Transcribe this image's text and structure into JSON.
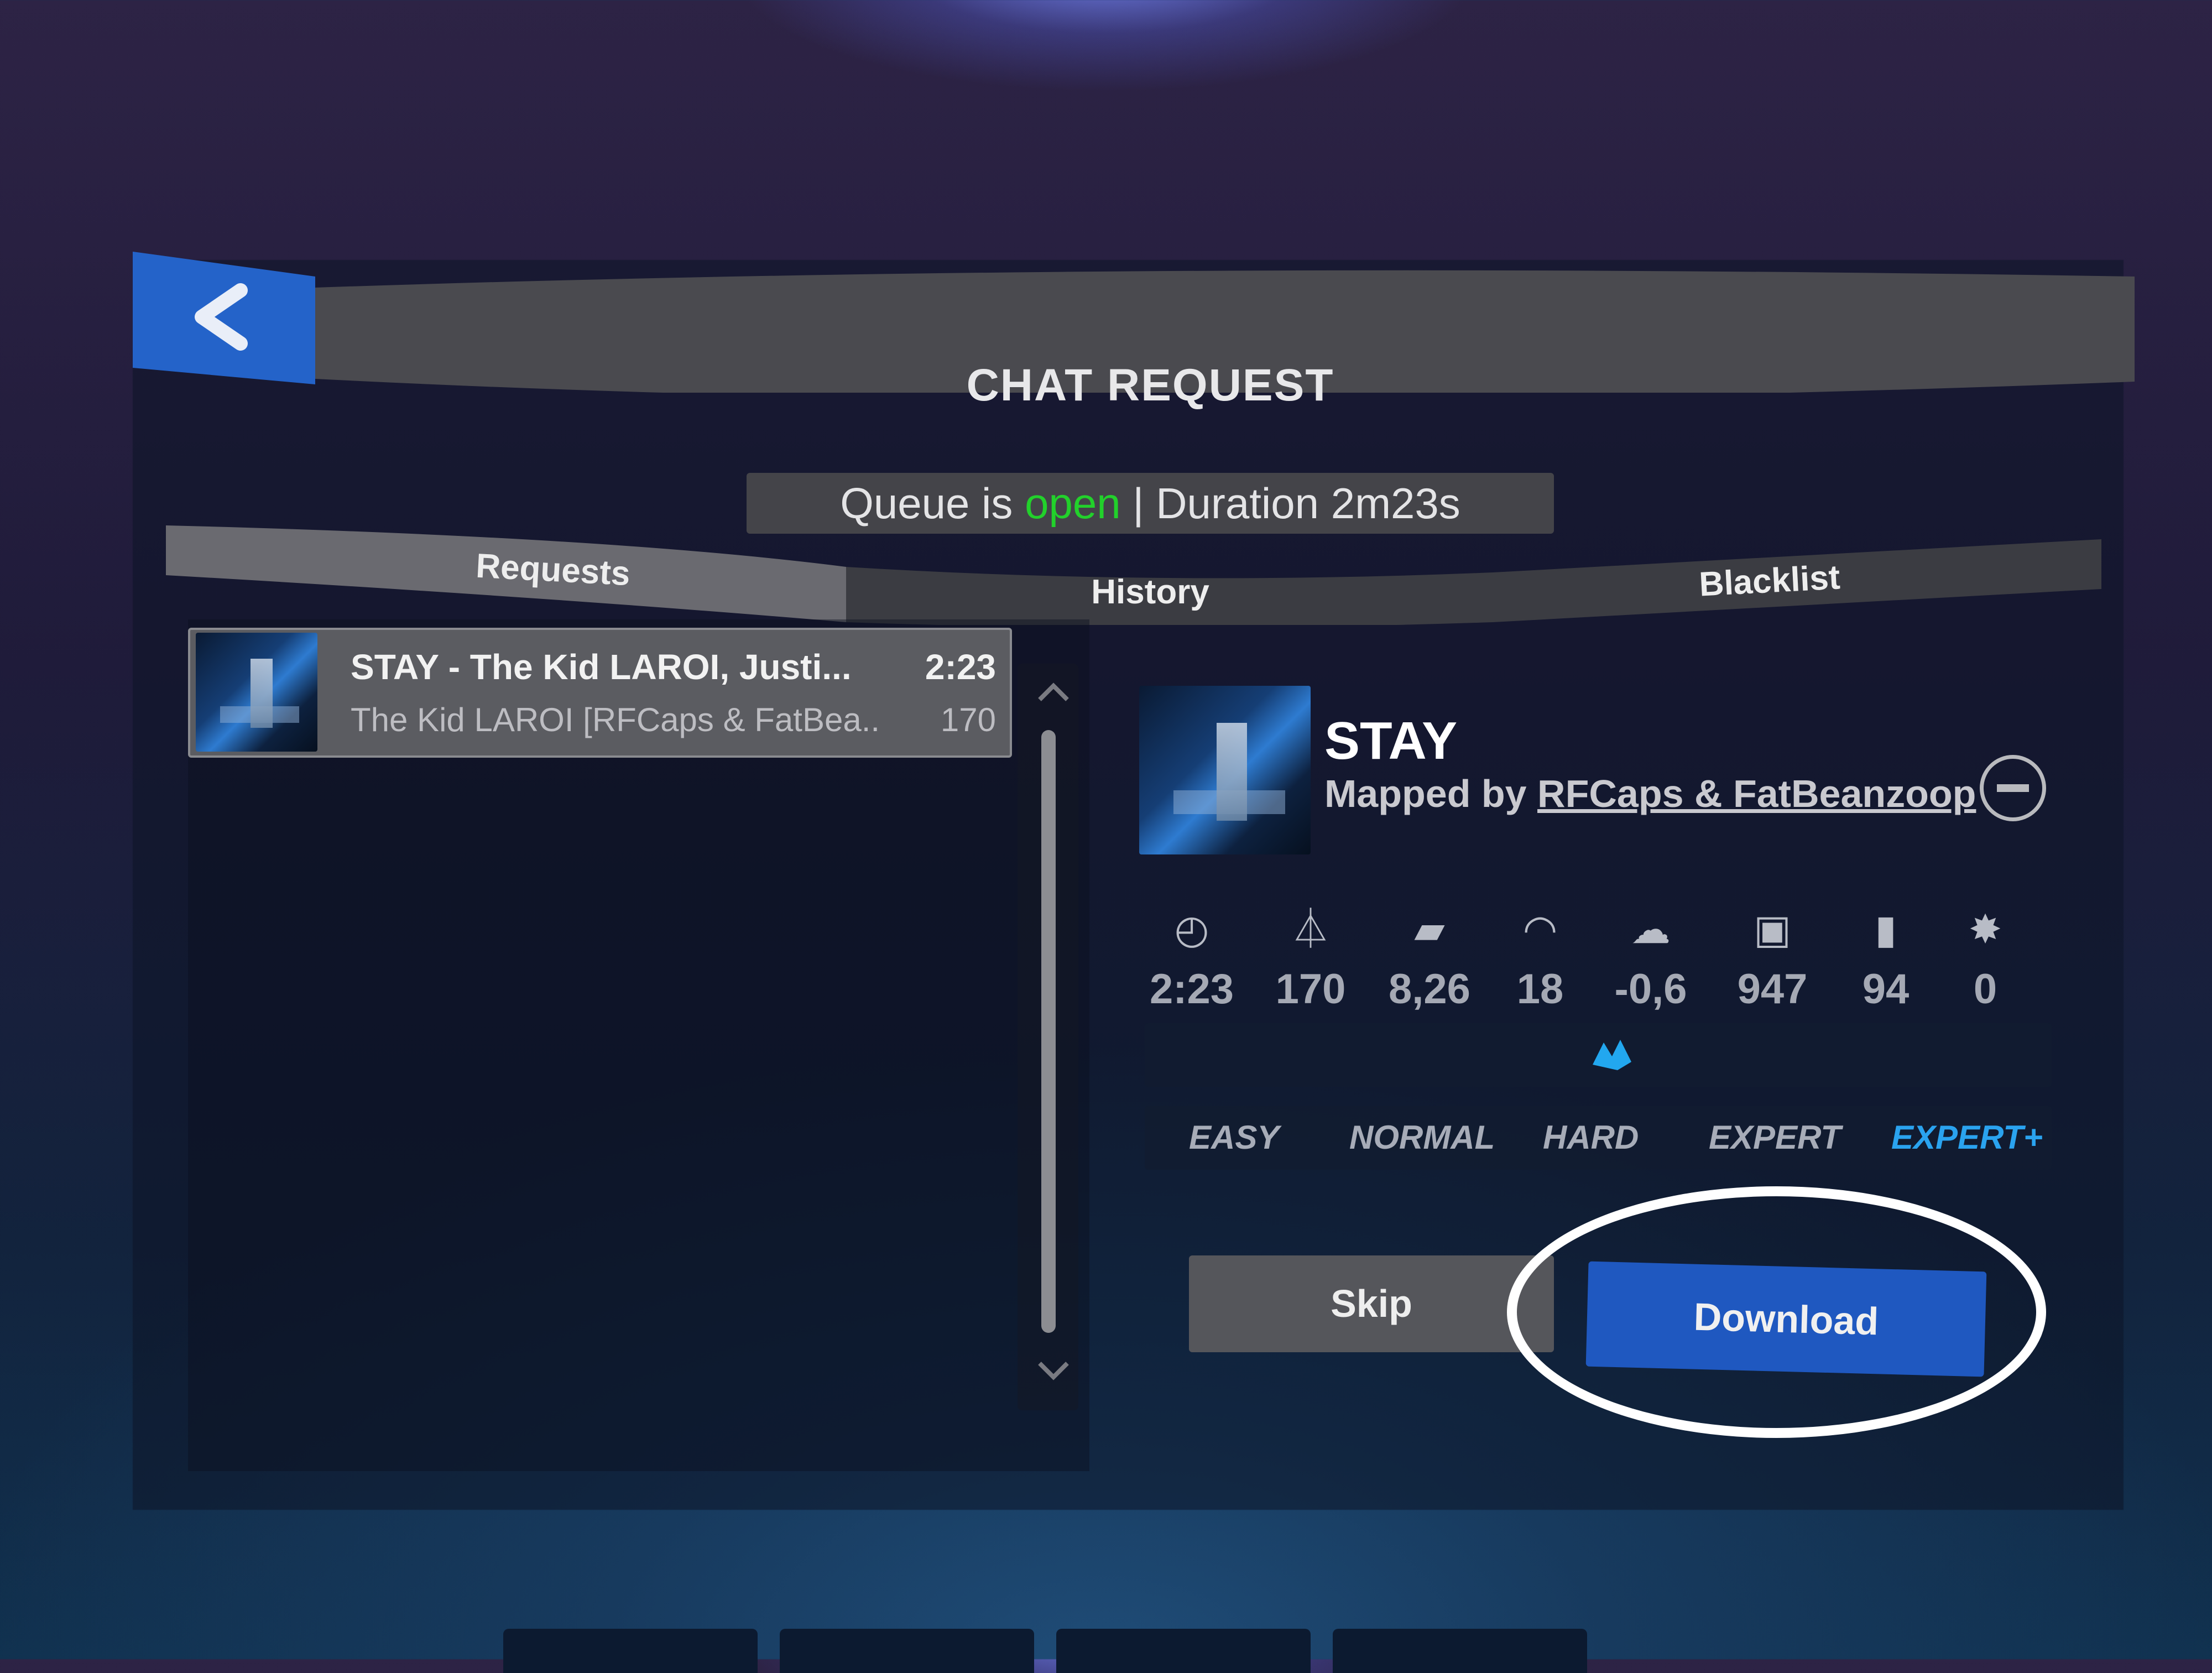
{
  "header": {
    "back_icon": "chevron-left-icon",
    "title": "CHAT REQUEST"
  },
  "queue": {
    "prefix": "Queue is ",
    "status": "open",
    "status_color": "#22d12b",
    "suffix": " | Duration 2m23s"
  },
  "tabs": [
    {
      "label": "Requests",
      "active": true
    },
    {
      "label": "History",
      "active": false
    },
    {
      "label": "Blacklist",
      "active": false
    }
  ],
  "requests": [
    {
      "title": "STAY - The Kid LAROI, Justi...",
      "subtitle": "The Kid LAROI [RFCaps & FatBea...",
      "duration": "2:23",
      "bpm": "170"
    }
  ],
  "detail": {
    "song_title": "STAY",
    "mapped_by_prefix": "Mapped by ",
    "mapper": "RFCaps & FatBeanzoop",
    "stats": [
      {
        "icon": "clock-icon",
        "glyph": "◴",
        "value": "2:23"
      },
      {
        "icon": "metronome-icon",
        "glyph": "⏃",
        "value": "170"
      },
      {
        "icon": "notes-per-second-icon",
        "glyph": "▰",
        "value": "8,26"
      },
      {
        "icon": "speed-icon",
        "glyph": "◠",
        "value": "18"
      },
      {
        "icon": "offset-icon",
        "glyph": "☁",
        "value": "-0,6"
      },
      {
        "icon": "notes-icon",
        "glyph": "▣",
        "value": "947"
      },
      {
        "icon": "walls-icon",
        "glyph": "▮",
        "value": "94"
      },
      {
        "icon": "bombs-icon",
        "glyph": "✸",
        "value": "0"
      }
    ],
    "characteristic_icon": "standard-mode-icon",
    "difficulties": [
      {
        "label": "EASY",
        "active": false
      },
      {
        "label": "NORMAL",
        "active": false
      },
      {
        "label": "HARD",
        "active": false
      },
      {
        "label": "EXPERT",
        "active": false
      },
      {
        "label": "EXPERT+",
        "active": true
      }
    ],
    "accent_color": "#2aa3ef"
  },
  "actions": {
    "skip_label": "Skip",
    "download_label": "Download",
    "download_color": "#1f58c0"
  }
}
